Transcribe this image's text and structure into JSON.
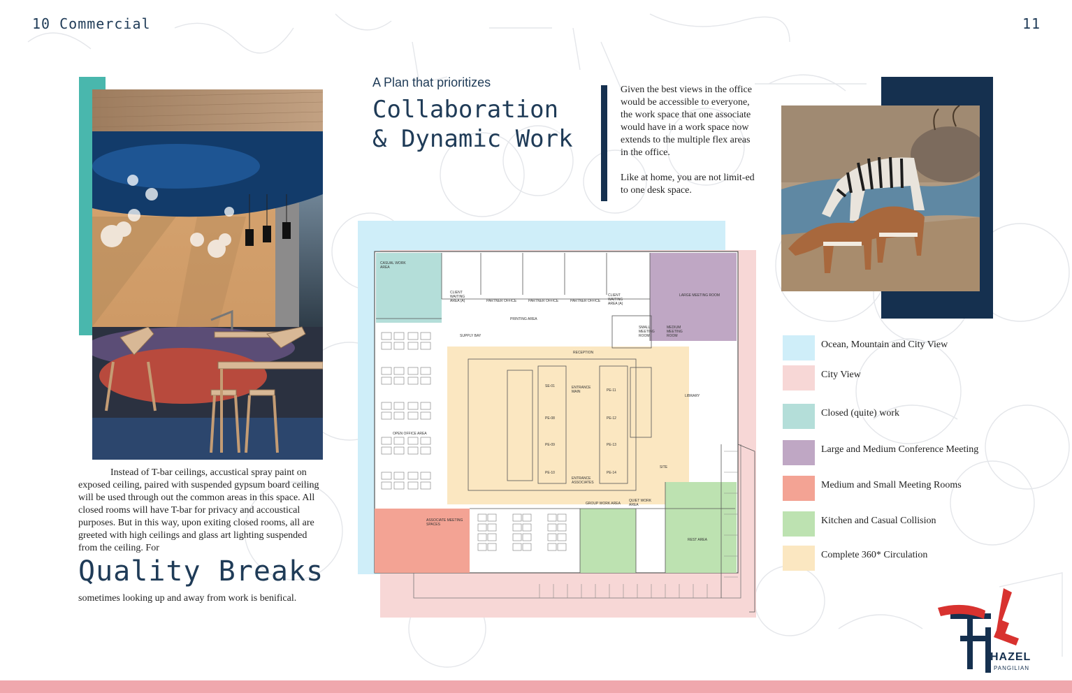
{
  "header": {
    "left_label": "10 Commercial",
    "page_number": "11"
  },
  "left": {
    "body_text": "Instead of T-bar ceilings, accustical spray paint on exposed ceiling, paired with suspended gypsum board ceiling will be used through out the common areas in this space. All closed rooms will have T-bar for privacy and accoustical purposes. But in this way, upon exiting closed rooms, all are greeted with high ceilings and glass art lighting suspended from the ceiling. For",
    "heading": "Quality Breaks",
    "caption": "sometimes looking up and away from work is benifical."
  },
  "center": {
    "kicker": "A Plan that prioritizes",
    "title_line1": "Collaboration",
    "title_line2": "& Dynamic Work",
    "para1": "Given the best views in the office would be accessible to everyone, the work space that one associate would have in a work space now extends to the multiple flex areas in the office.",
    "para2": "Like at home, you are not limit-ed to one desk space."
  },
  "plan_labels": {
    "casual_work": "CASUAL WORK AREA",
    "client_waiting_a": "CLIENT WAITING AREA (A)",
    "partner_office_1": "PARTNER OFFICE",
    "partner_office_2": "PARTNER OFFICE",
    "partner_office_3": "PARTNER OFFICE",
    "client_waiting_b": "CLIENT WAITING AREA (A)",
    "large_meeting": "LARGE MEETING ROOM",
    "supply_bay": "SUPPLY BAY",
    "printing": "PRINTING AREA",
    "small_meeting": "SMALL MEETING ROOM",
    "medium_meeting": "MEDIUM MEETING ROOM",
    "reception": "RECEPTION",
    "entrance_main": "ENTRANCE MAIN",
    "library": "LIBRARY",
    "open_office": "OPEN OFFICE AREA",
    "site": "SITE",
    "entrance_associates": "ENTRANCE ASSOCIATES",
    "group_work": "GROUP WORK AREA",
    "quiet_work": "QUIET WORK AREA",
    "associate_meeting": "ASSOCIATE MEETING SPACES",
    "rest_area": "REST AREA",
    "se01": "SE-01",
    "pe08": "PE-08",
    "pe09": "PE-09",
    "pe10": "PE-10",
    "pe11": "PE-11",
    "pe12": "PE-12",
    "pe13": "PE-13",
    "pe14": "PE-14"
  },
  "legend": [
    {
      "label": "Ocean, Mountain and City View",
      "color": "#cfeef9"
    },
    {
      "label": "City View",
      "color": "#f7d7d6"
    },
    {
      "label": "Closed (quite) work",
      "color": "#b4ded9"
    },
    {
      "label": "Large and Medium Conference Meeting",
      "color": "#bfa7c4"
    },
    {
      "label": "Medium and Small Meeting Rooms",
      "color": "#f3a394"
    },
    {
      "label": "Kitchen and Casual Collision",
      "color": "#bde2b1"
    },
    {
      "label": "Complete 360* Circulation",
      "color": "#fbe7c1"
    }
  ],
  "logo": {
    "name": "HAZEL",
    "surname": "PANGILIAN"
  }
}
